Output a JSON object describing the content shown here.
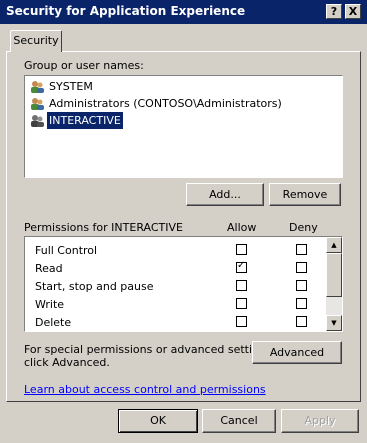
{
  "window": {
    "title": "Security for Application Experience",
    "help_label": "?",
    "close_label": "X"
  },
  "tab": {
    "label": "Security"
  },
  "groups": {
    "label": "Group or user names:",
    "items": [
      {
        "label": "SYSTEM",
        "icon": "users-icon"
      },
      {
        "label": "Administrators (CONTOSO\\Administrators)",
        "icon": "users-icon"
      },
      {
        "label": "INTERACTIVE",
        "icon": "users-icon",
        "selected": true
      }
    ],
    "add_label": "Add...",
    "remove_label": "Remove"
  },
  "permissions": {
    "label": "Permissions for INTERACTIVE",
    "allow_label": "Allow",
    "deny_label": "Deny",
    "rows": [
      {
        "name": "Full Control",
        "allow": false,
        "deny": false
      },
      {
        "name": "Read",
        "allow": true,
        "deny": false
      },
      {
        "name": "Start, stop and pause",
        "allow": false,
        "deny": false
      },
      {
        "name": "Write",
        "allow": false,
        "deny": false
      },
      {
        "name": "Delete",
        "allow": false,
        "deny": false
      }
    ]
  },
  "advanced": {
    "text_line1": "For special permissions or advanced settings,",
    "text_line2": "click Advanced.",
    "button_label": "Advanced"
  },
  "help_link": "Learn about access control and permissions",
  "footer": {
    "ok_label": "OK",
    "cancel_label": "Cancel",
    "apply_label": "Apply"
  }
}
